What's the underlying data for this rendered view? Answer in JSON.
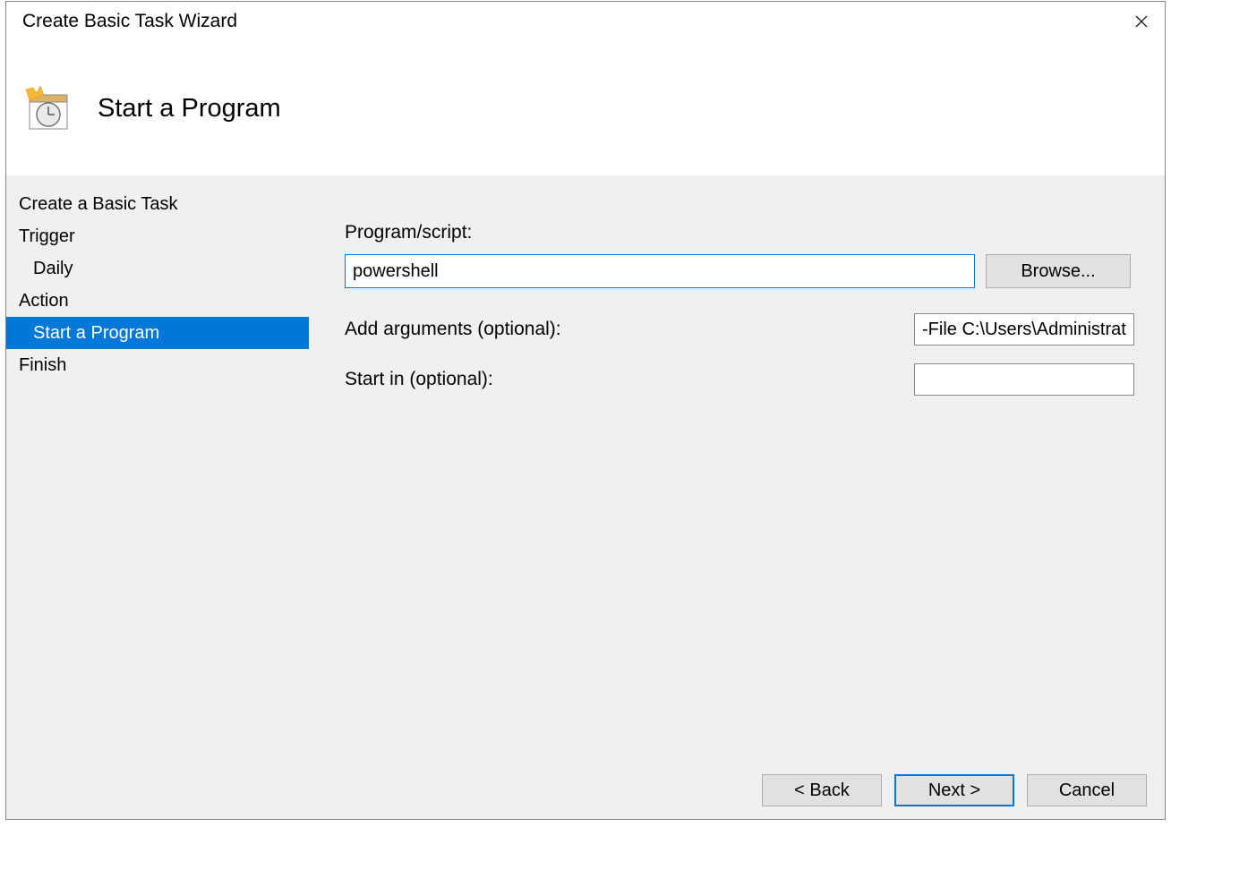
{
  "window": {
    "title": "Create Basic Task Wizard"
  },
  "header": {
    "title": "Start a Program"
  },
  "sidebar": {
    "items": [
      {
        "label": "Create a Basic Task",
        "indent": false,
        "selected": false
      },
      {
        "label": "Trigger",
        "indent": false,
        "selected": false
      },
      {
        "label": "Daily",
        "indent": true,
        "selected": false
      },
      {
        "label": "Action",
        "indent": false,
        "selected": false
      },
      {
        "label": "Start a Program",
        "indent": true,
        "selected": true
      },
      {
        "label": "Finish",
        "indent": false,
        "selected": false
      }
    ]
  },
  "fields": {
    "program_label": "Program/script:",
    "program_value": "powershell",
    "browse_label": "Browse...",
    "arguments_label": "Add arguments (optional):",
    "arguments_value": "-File C:\\Users\\Administrat",
    "startin_label": "Start in (optional):",
    "startin_value": ""
  },
  "footer": {
    "back": "< Back",
    "next": "Next >",
    "cancel": "Cancel"
  }
}
